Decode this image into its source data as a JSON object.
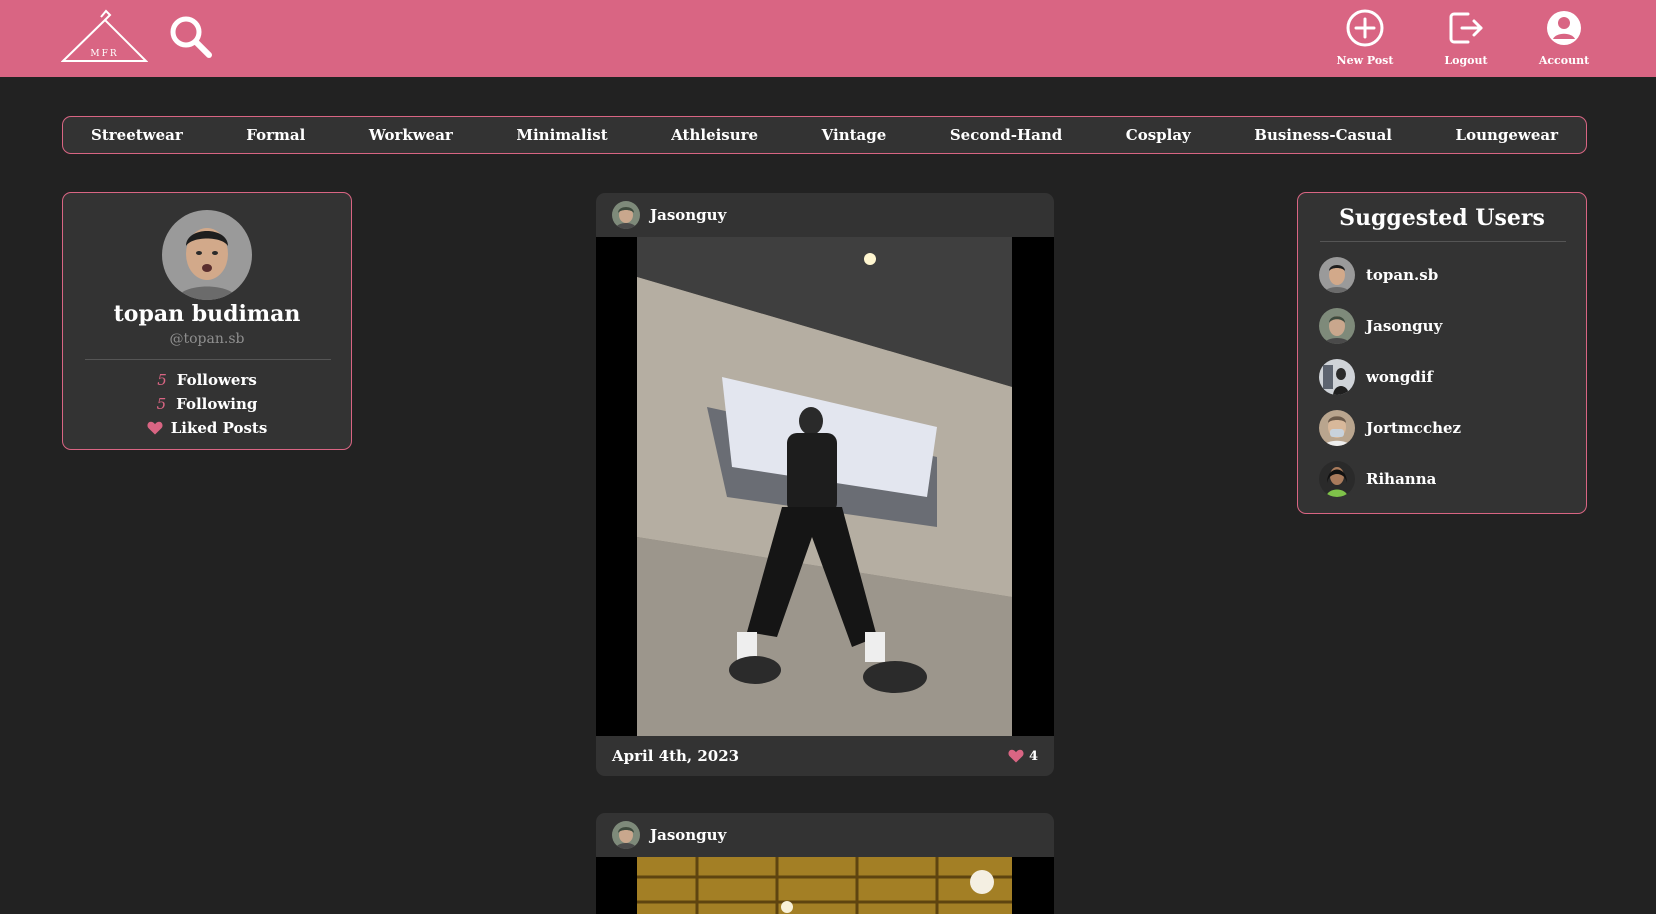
{
  "header": {
    "logo_text": "MFR",
    "actions": [
      {
        "label": "New Post",
        "icon": "plus-circle-icon"
      },
      {
        "label": "Logout",
        "icon": "logout-icon"
      },
      {
        "label": "Account",
        "icon": "account-icon"
      }
    ]
  },
  "categories": [
    "Streetwear",
    "Formal",
    "Workwear",
    "Minimalist",
    "Athleisure",
    "Vintage",
    "Second-Hand",
    "Cosplay",
    "Business-Casual",
    "Loungewear"
  ],
  "profile": {
    "name": "topan budiman",
    "handle": "@topan.sb",
    "followers_count": "5",
    "followers_label": "Followers",
    "following_count": "5",
    "following_label": "Following",
    "liked_label": "Liked Posts"
  },
  "posts": [
    {
      "username": "Jasonguy",
      "date": "April 4th, 2023",
      "likes": "4"
    },
    {
      "username": "Jasonguy"
    }
  ],
  "suggested": {
    "title": "Suggested Users",
    "users": [
      {
        "name": "topan.sb"
      },
      {
        "name": "Jasonguy"
      },
      {
        "name": "wongdif"
      },
      {
        "name": "Jortmcchez"
      },
      {
        "name": "Rihanna"
      }
    ]
  },
  "colors": {
    "accent": "#d96583",
    "background": "#222222",
    "card": "#333333",
    "muted": "#8f8f8f"
  }
}
